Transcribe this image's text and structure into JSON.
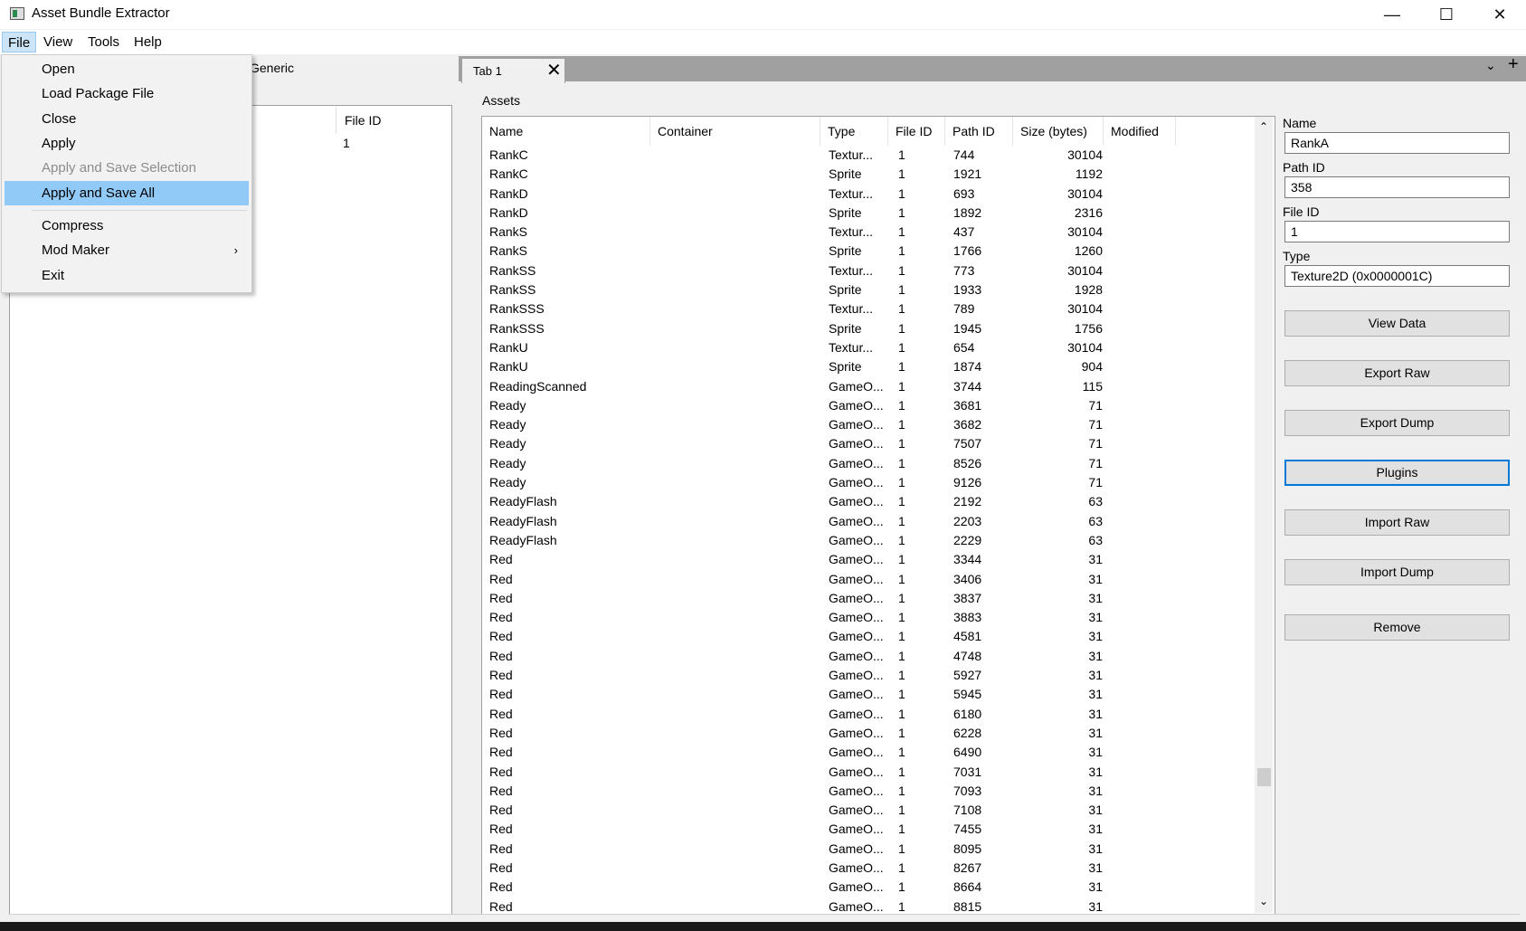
{
  "window": {
    "title": "Asset Bundle Extractor",
    "minimize_glyph": "—",
    "maximize_glyph": "☐",
    "close_glyph": "✕"
  },
  "menubar": [
    "File",
    "View",
    "Tools",
    "Help"
  ],
  "file_menu": {
    "items": [
      {
        "label": "Open",
        "enabled": true
      },
      {
        "label": "Load Package File",
        "enabled": true
      },
      {
        "label": "Close",
        "enabled": true
      },
      {
        "label": "Apply",
        "enabled": true
      },
      {
        "label": "Apply and Save Selection",
        "enabled": false
      },
      {
        "label": "Apply and Save All",
        "enabled": true,
        "highlighted": true
      },
      {
        "label": "Compress",
        "enabled": true
      },
      {
        "label": "Mod Maker",
        "enabled": true,
        "submenu": true
      },
      {
        "label": "Exit",
        "enabled": true
      }
    ],
    "submenu_glyph": "›"
  },
  "left_panel": {
    "generic_label": "Generic",
    "column_file_id": "File ID",
    "row_file_id": "1"
  },
  "tabs": {
    "tab1_label": "Tab 1",
    "close_glyph": "✕",
    "chevron_glyph": "⌄",
    "add_glyph": "+"
  },
  "assets": {
    "label": "Assets",
    "columns": [
      "Name",
      "Container",
      "Type",
      "File ID",
      "Path ID",
      "Size (bytes)",
      "Modified"
    ],
    "rows": [
      [
        "RankC",
        "Textur...",
        "1",
        "744",
        "30104"
      ],
      [
        "RankC",
        "Sprite",
        "1",
        "1921",
        "1192"
      ],
      [
        "RankD",
        "Textur...",
        "1",
        "693",
        "30104"
      ],
      [
        "RankD",
        "Sprite",
        "1",
        "1892",
        "2316"
      ],
      [
        "RankS",
        "Textur...",
        "1",
        "437",
        "30104"
      ],
      [
        "RankS",
        "Sprite",
        "1",
        "1766",
        "1260"
      ],
      [
        "RankSS",
        "Textur...",
        "1",
        "773",
        "30104"
      ],
      [
        "RankSS",
        "Sprite",
        "1",
        "1933",
        "1928"
      ],
      [
        "RankSSS",
        "Textur...",
        "1",
        "789",
        "30104"
      ],
      [
        "RankSSS",
        "Sprite",
        "1",
        "1945",
        "1756"
      ],
      [
        "RankU",
        "Textur...",
        "1",
        "654",
        "30104"
      ],
      [
        "RankU",
        "Sprite",
        "1",
        "1874",
        "904"
      ],
      [
        "ReadingScanned",
        "GameO...",
        "1",
        "3744",
        "115"
      ],
      [
        "Ready",
        "GameO...",
        "1",
        "3681",
        "71"
      ],
      [
        "Ready",
        "GameO...",
        "1",
        "3682",
        "71"
      ],
      [
        "Ready",
        "GameO...",
        "1",
        "7507",
        "71"
      ],
      [
        "Ready",
        "GameO...",
        "1",
        "8526",
        "71"
      ],
      [
        "Ready",
        "GameO...",
        "1",
        "9126",
        "71"
      ],
      [
        "ReadyFlash",
        "GameO...",
        "1",
        "2192",
        "63"
      ],
      [
        "ReadyFlash",
        "GameO...",
        "1",
        "2203",
        "63"
      ],
      [
        "ReadyFlash",
        "GameO...",
        "1",
        "2229",
        "63"
      ],
      [
        "Red",
        "GameO...",
        "1",
        "3344",
        "31"
      ],
      [
        "Red",
        "GameO...",
        "1",
        "3406",
        "31"
      ],
      [
        "Red",
        "GameO...",
        "1",
        "3837",
        "31"
      ],
      [
        "Red",
        "GameO...",
        "1",
        "3883",
        "31"
      ],
      [
        "Red",
        "GameO...",
        "1",
        "4581",
        "31"
      ],
      [
        "Red",
        "GameO...",
        "1",
        "4748",
        "31"
      ],
      [
        "Red",
        "GameO...",
        "1",
        "5927",
        "31"
      ],
      [
        "Red",
        "GameO...",
        "1",
        "5945",
        "31"
      ],
      [
        "Red",
        "GameO...",
        "1",
        "6180",
        "31"
      ],
      [
        "Red",
        "GameO...",
        "1",
        "6228",
        "31"
      ],
      [
        "Red",
        "GameO...",
        "1",
        "6490",
        "31"
      ],
      [
        "Red",
        "GameO...",
        "1",
        "7031",
        "31"
      ],
      [
        "Red",
        "GameO...",
        "1",
        "7093",
        "31"
      ],
      [
        "Red",
        "GameO...",
        "1",
        "7108",
        "31"
      ],
      [
        "Red",
        "GameO...",
        "1",
        "7455",
        "31"
      ],
      [
        "Red",
        "GameO...",
        "1",
        "8095",
        "31"
      ],
      [
        "Red",
        "GameO...",
        "1",
        "8267",
        "31"
      ],
      [
        "Red",
        "GameO...",
        "1",
        "8664",
        "31"
      ],
      [
        "Red",
        "GameO...",
        "1",
        "8815",
        "31"
      ]
    ]
  },
  "properties": {
    "name_label": "Name",
    "name_value": "RankA",
    "path_id_label": "Path ID",
    "path_id_value": "358",
    "file_id_label": "File ID",
    "file_id_value": "1",
    "type_label": "Type",
    "type_value": "Texture2D (0x0000001C)",
    "buttons": [
      "View Data",
      "Export Raw",
      "Export Dump",
      "Plugins",
      "Import Raw",
      "Import Dump",
      "Remove"
    ]
  },
  "scrollbar": {
    "up_glyph": "⌃",
    "down_glyph": "⌄"
  },
  "colors": {
    "menu_highlight": "#91c9f7",
    "focus_border": "#0078d7"
  }
}
